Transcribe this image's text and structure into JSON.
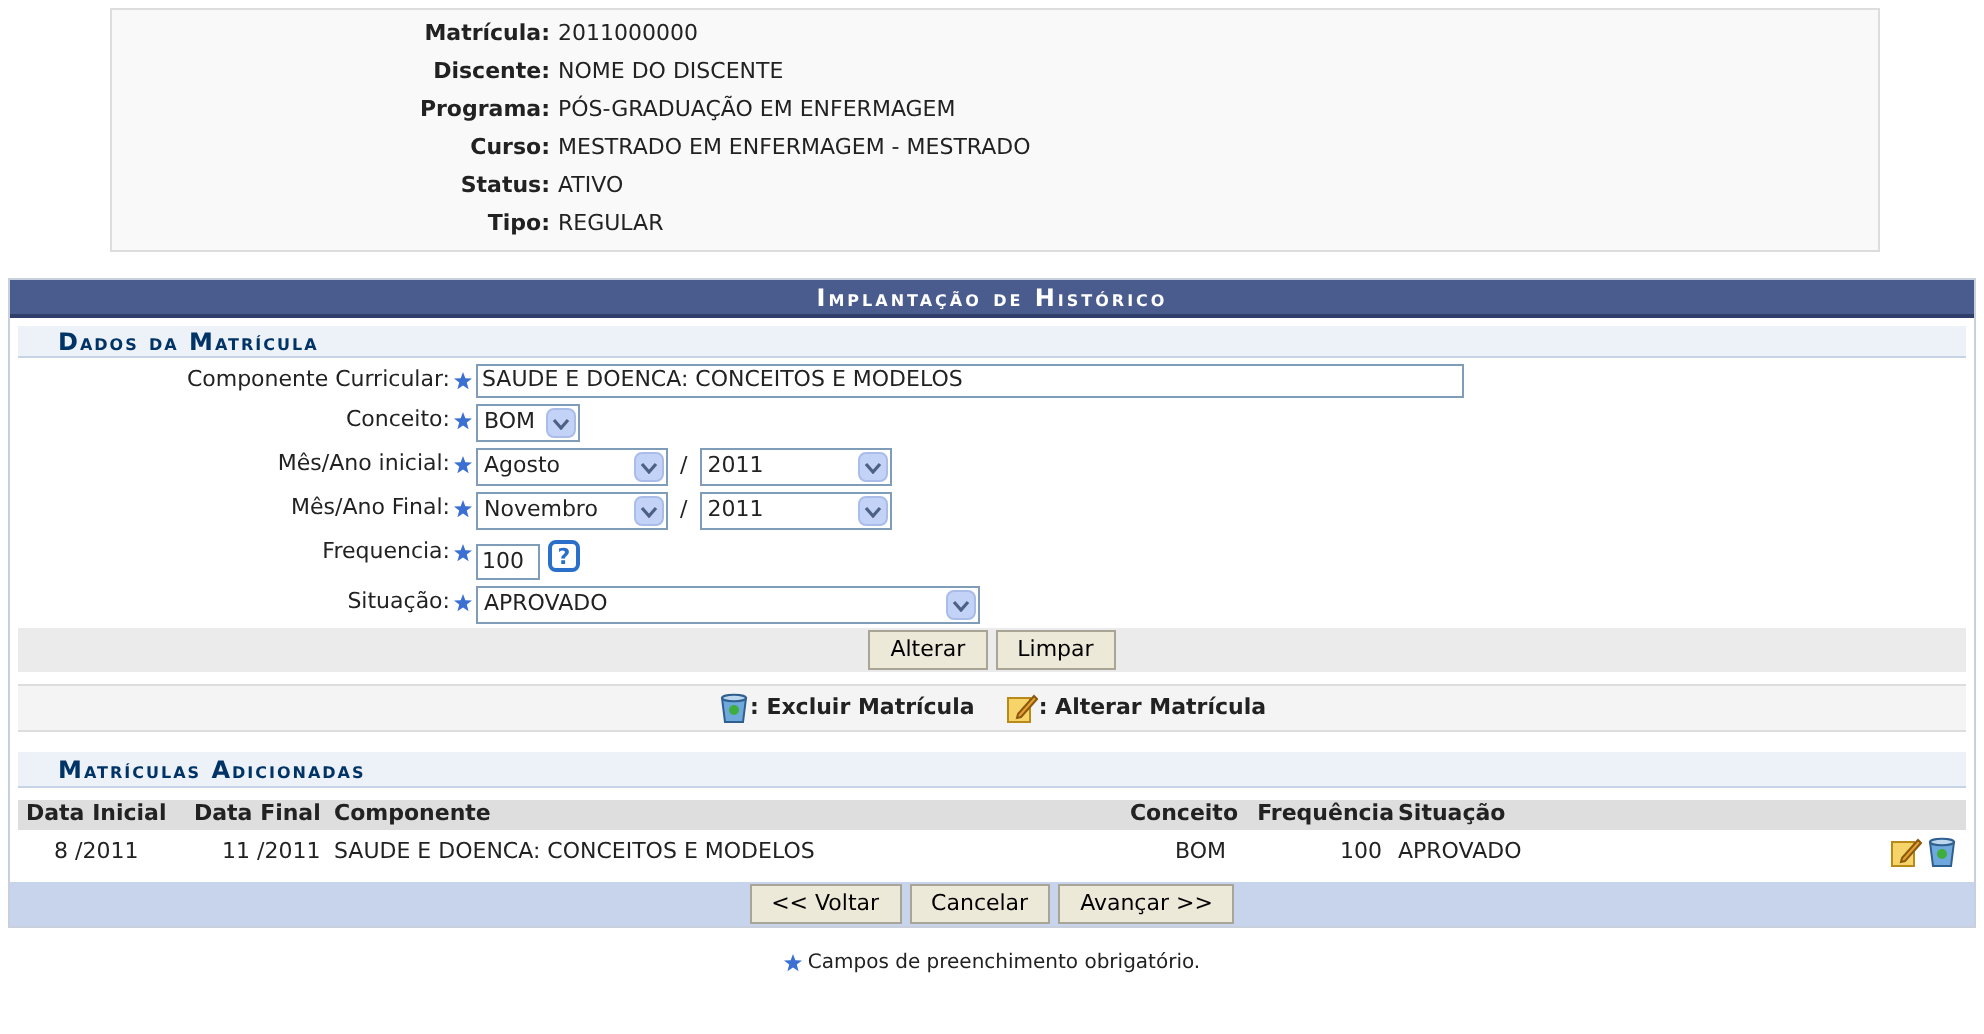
{
  "student_info": [
    {
      "label": "Matrícula:",
      "value": "2011000000"
    },
    {
      "label": "Discente:",
      "value": "NOME DO DISCENTE"
    },
    {
      "label": "Programa:",
      "value": "PÓS-GRADUAÇÃO EM ENFERMAGEM"
    },
    {
      "label": "Curso:",
      "value": "MESTRADO EM ENFERMAGEM - MESTRADO"
    },
    {
      "label": "Status:",
      "value": "ATIVO"
    },
    {
      "label": "Tipo:",
      "value": "REGULAR"
    }
  ],
  "panel_title": "Implantação de Histórico",
  "form": {
    "title": "Dados da Matrícula",
    "fields": [
      {
        "kind": "text",
        "label": "Componente Curricular:",
        "value": "SAUDE E DOENCA: CONCEITOS E MODELOS"
      },
      {
        "kind": "select",
        "label": "Conceito:",
        "value": "BOM"
      },
      {
        "kind": "month_year",
        "label": "Mês/Ano inicial:",
        "month": "Agosto",
        "separator": "/",
        "year": "2011"
      },
      {
        "kind": "month_year",
        "label": "Mês/Ano Final:",
        "month": "Novembro",
        "separator": "/",
        "year": "2011"
      },
      {
        "kind": "number",
        "label": "Frequencia:",
        "value": "100",
        "help": "?"
      },
      {
        "kind": "wide_select",
        "label": "Situação:",
        "value": "APROVADO"
      }
    ],
    "buttons": [
      "Alterar",
      "Limpar"
    ]
  },
  "legend": [
    {
      "kind": "delete",
      "label": ": Excluir Matrícula"
    },
    {
      "kind": "edit",
      "label": ": Alterar Matrícula"
    }
  ],
  "table": {
    "title": "Matrículas Adicionadas",
    "columns": [
      "Data Inicial",
      "Data Final",
      "Componente",
      "Conceito",
      "Frequência",
      "Situação"
    ],
    "rows": [
      {
        "cells": [
          "8 /2011",
          "11 /2011",
          "SAUDE E DOENCA: CONCEITOS E MODELOS",
          "BOM",
          "100",
          "APROVADO"
        ]
      }
    ]
  },
  "footer_buttons": [
    "<< Voltar",
    "Cancelar",
    "Avançar >>"
  ],
  "required_note": "Campos de preenchimento obrigatório."
}
